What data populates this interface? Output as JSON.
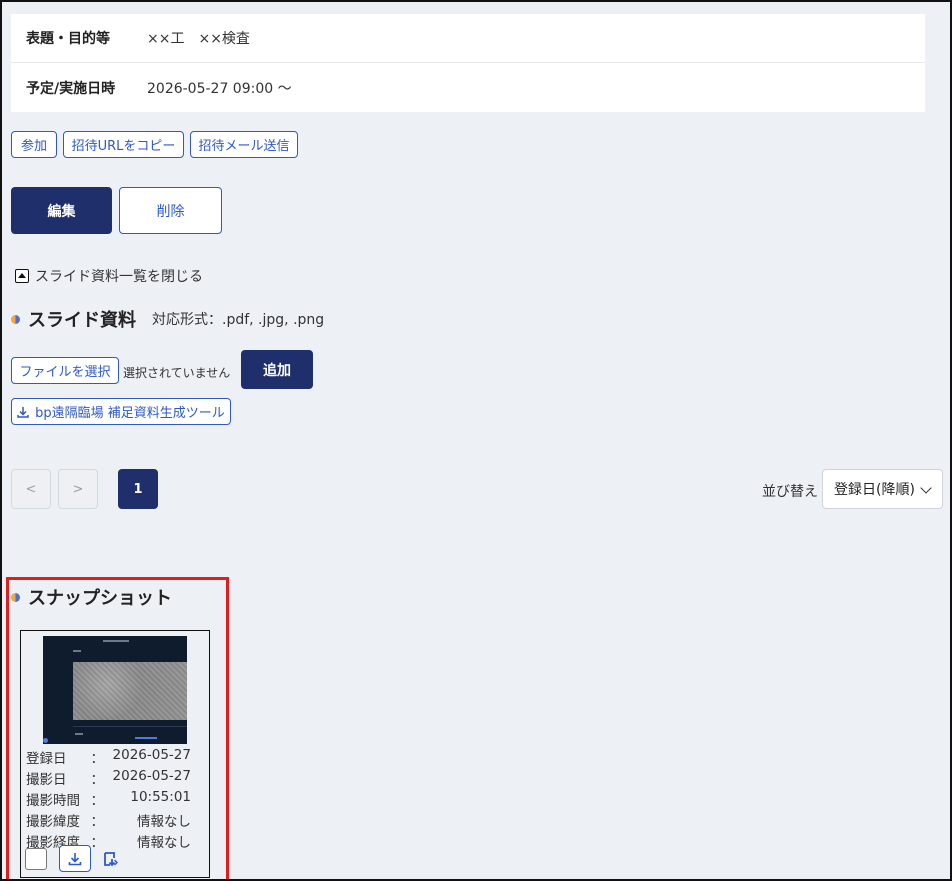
{
  "info": {
    "title_label": "表題・目的等",
    "title_value": "××工　××検査",
    "date_label": "予定/実施日時",
    "date_value": "2026-05-27 09:00 〜"
  },
  "actions": {
    "join": "参加",
    "copy_url": "招待URLをコピー",
    "send_mail": "招待メール送信",
    "edit": "編集",
    "delete": "削除"
  },
  "slides": {
    "collapse_label": "スライド資料一覧を閉じる",
    "title": "スライド資料",
    "formats": "対応形式：.pdf, .jpg, .png",
    "select_file": "ファイルを選択",
    "file_status": "選択されていません",
    "add": "追加",
    "tool_link": "bp遠隔臨場 補足資料生成ツール"
  },
  "pagination": {
    "prev": "<",
    "next": ">",
    "current": "1"
  },
  "sort": {
    "label": "並び替え",
    "selected": "登録日(降順)"
  },
  "snapshot": {
    "title": "スナップショット",
    "items": [
      {
        "registered_label": "登録日",
        "registered_value": "2026-05-27",
        "taken_label": "撮影日",
        "taken_value": "2026-05-27",
        "time_label": "撮影時間",
        "time_value": "10:55:01",
        "lat_label": "撮影緯度",
        "lat_value": "情報なし",
        "lng_label": "撮影経度",
        "lng_value": "情報なし",
        "colon": "："
      }
    ]
  },
  "colors": {
    "primary": "#1f2f6b",
    "link": "#2f59c4",
    "background": "#edf0f5",
    "highlight": "#e11d1d"
  },
  "icons": [
    "collapse-up-icon",
    "section-dot-icon",
    "download-icon",
    "chevron-down-icon",
    "export-icon"
  ]
}
